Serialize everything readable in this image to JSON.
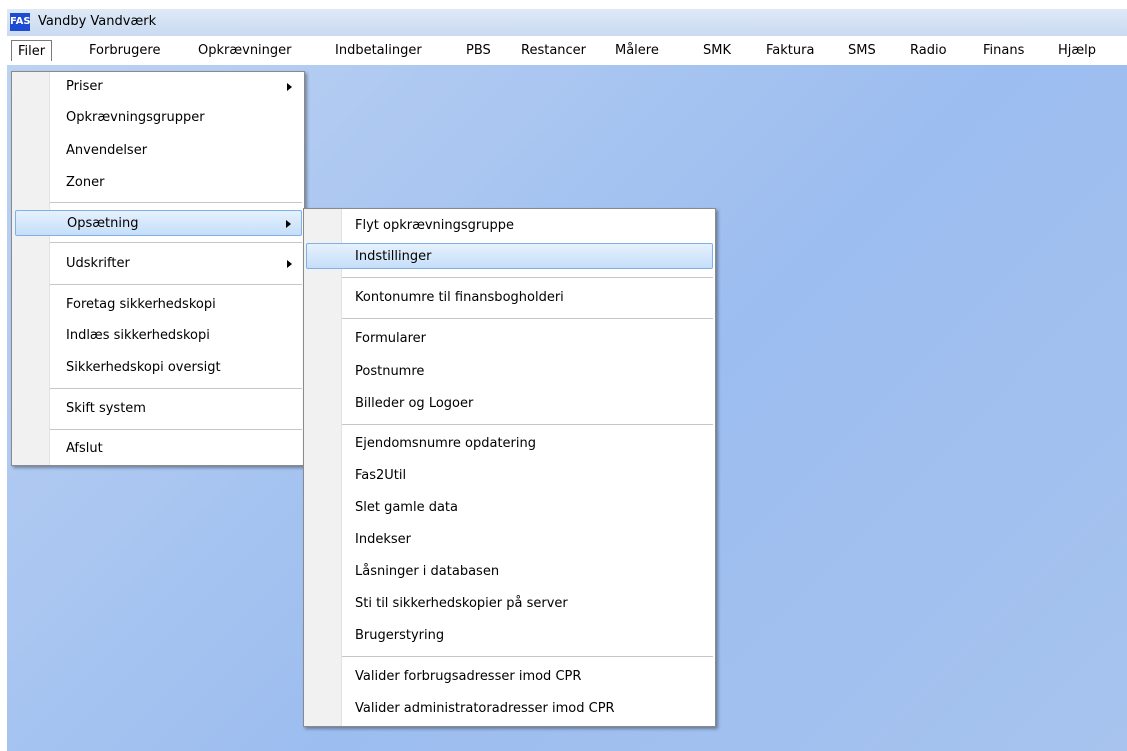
{
  "window": {
    "title": "Vandby Vandværk",
    "icon_text": "FAS"
  },
  "menubar": {
    "items": [
      "Filer",
      "Forbrugere",
      "Opkrævninger",
      "Indbetalinger",
      "PBS",
      "Restancer",
      "Målere",
      "SMK",
      "Faktura",
      "SMS",
      "Radio",
      "Finans",
      "Hjælp"
    ]
  },
  "filer_menu": {
    "items": [
      "Priser",
      "Opkrævningsgrupper",
      "Anvendelser",
      "Zoner",
      "Opsætning",
      "Udskrifter",
      "Foretag sikkerhedskopi",
      "Indlæs sikkerhedskopi",
      "Sikkerhedskopi oversigt",
      "Skift system",
      "Afslut"
    ]
  },
  "opsaetning_menu": {
    "items": [
      "Flyt opkrævningsgruppe",
      "Indstillinger",
      "Kontonumre til finansbogholderi",
      "Formularer",
      "Postnumre",
      "Billeder og Logoer",
      "Ejendomsnumre opdatering",
      "Fas2Util",
      "Slet gamle data",
      "Indekser",
      "Låsninger i databasen",
      "Sti til sikkerhedskopier på server",
      "Brugerstyring",
      "Valider forbrugsadresser imod CPR",
      "Valider administratoradresser imod CPR"
    ]
  }
}
